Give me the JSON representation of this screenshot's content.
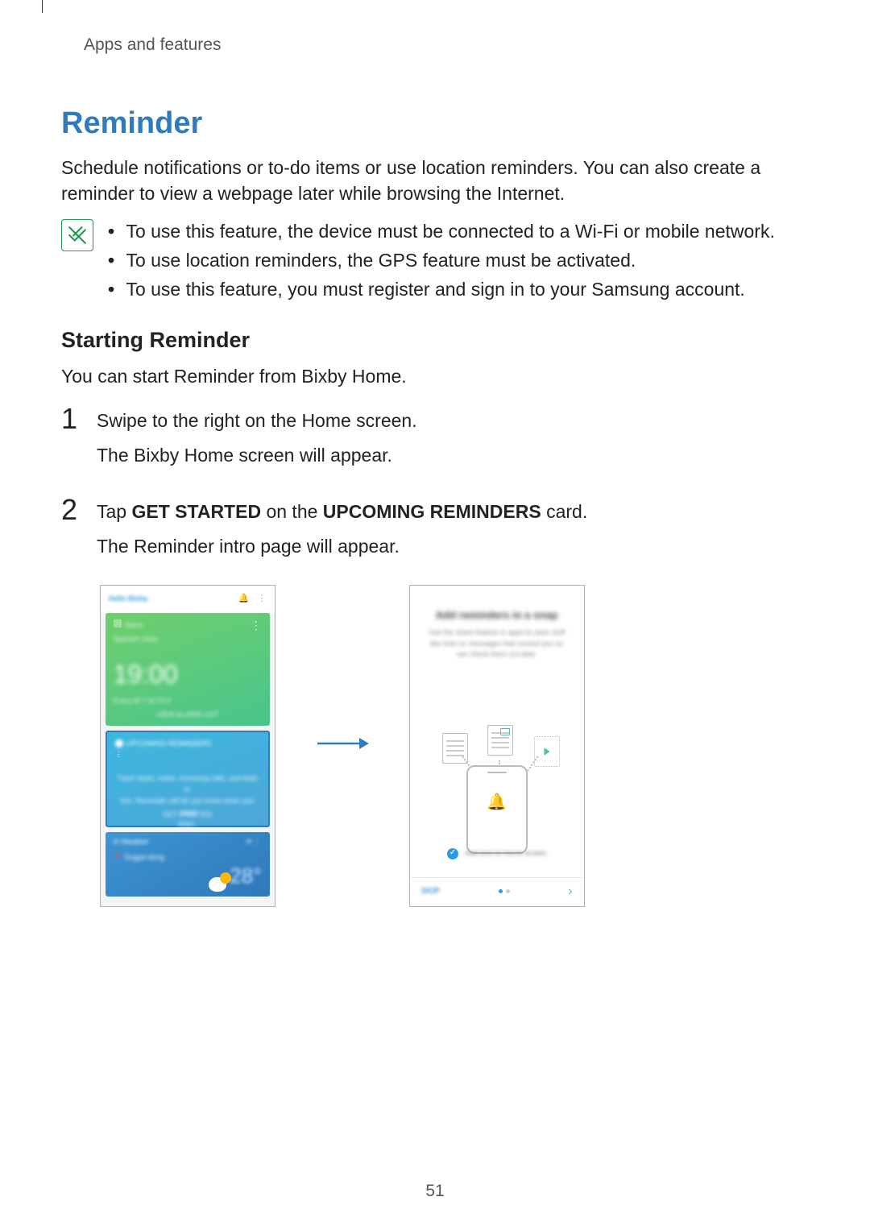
{
  "header": {
    "section": "Apps and features"
  },
  "title": "Reminder",
  "intro": "Schedule notifications or to-do items or use location reminders. You can also create a reminder to view a webpage later while browsing the Internet.",
  "notes": [
    "To use this feature, the device must be connected to a Wi-Fi or mobile network.",
    "To use location reminders, the GPS feature must be activated.",
    "To use this feature, you must register and sign in to your Samsung account."
  ],
  "subheading": "Starting Reminder",
  "subintro": "You can start Reminder from Bixby Home.",
  "steps": {
    "1": {
      "line1": "Swipe to the right on the Home screen.",
      "line2": "The Bixby Home screen will appear."
    },
    "2": {
      "prefix": "Tap ",
      "b1": "GET STARTED",
      "mid": " on the ",
      "b2": "UPCOMING REMINDERS",
      "suffix": " card.",
      "line2": "The Reminder intro page will appear."
    }
  },
  "left_phone": {
    "greeting": "Hello Bixby",
    "clock": "19:00",
    "weather_temp": "28°"
  },
  "page_number": "51"
}
